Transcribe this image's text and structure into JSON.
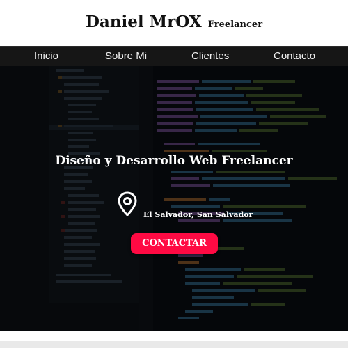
{
  "brand": {
    "name": "Daniel MrOX",
    "subtitle": "Freelancer"
  },
  "nav": {
    "items": [
      {
        "label": "Inicio"
      },
      {
        "label": "Sobre Mi"
      },
      {
        "label": "Clientes"
      },
      {
        "label": "Contacto"
      }
    ]
  },
  "hero": {
    "title": "Diseño y Desarrollo Web Freelancer",
    "location": "El Salvador, San Salvador",
    "cta_label": "CONTACTAR",
    "background_icon": "code-editor-screenshot",
    "location_icon": "map-pin-icon"
  },
  "colors": {
    "nav_bg": "#161616",
    "cta": "#ff0a43",
    "hero_text": "#ffffff"
  }
}
